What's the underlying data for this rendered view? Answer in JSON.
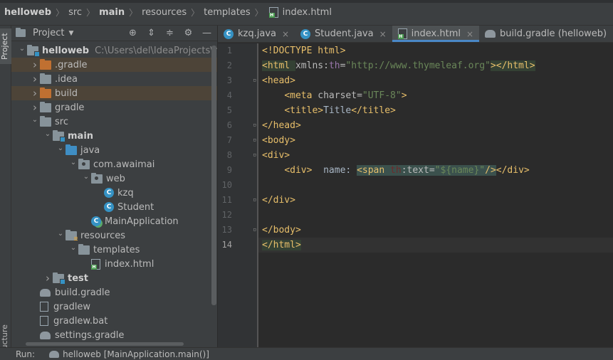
{
  "breadcrumb": [
    "helloweb",
    "src",
    "main",
    "resources",
    "templates",
    "index.html"
  ],
  "left_strip": {
    "project_tab": "Project",
    "structure_tab": "ructure"
  },
  "project_panel": {
    "title": "Project",
    "tools": [
      "locate-icon",
      "expand-all-icon",
      "collapse-all-icon",
      "gear-icon",
      "minimize-icon"
    ],
    "tree": [
      {
        "label": "helloweb",
        "extra": "C:\\Users\\del\\IdeaProjects\\hello",
        "icon": "module-folder-icon",
        "indent": 0,
        "expanded": true,
        "bold": true
      },
      {
        "label": ".gradle",
        "icon": "excluded-folder-icon",
        "indent": 1,
        "expanded": false,
        "hl": true
      },
      {
        "label": ".idea",
        "icon": "folder-icon",
        "indent": 1,
        "expanded": false
      },
      {
        "label": "build",
        "icon": "excluded-folder-icon",
        "indent": 1,
        "expanded": false,
        "hl": true
      },
      {
        "label": "gradle",
        "icon": "folder-icon",
        "indent": 1,
        "expanded": false
      },
      {
        "label": "src",
        "icon": "folder-icon",
        "indent": 1,
        "expanded": true
      },
      {
        "label": "main",
        "icon": "module-folder-icon",
        "indent": 2,
        "expanded": true,
        "bold": true
      },
      {
        "label": "java",
        "icon": "source-folder-icon",
        "indent": 3,
        "expanded": true
      },
      {
        "label": "com.awaimai",
        "icon": "package-icon",
        "indent": 4,
        "expanded": true
      },
      {
        "label": "web",
        "icon": "package-icon",
        "indent": 5,
        "expanded": true
      },
      {
        "label": "kzq",
        "icon": "class-icon",
        "indent": 6
      },
      {
        "label": "Student",
        "icon": "class-icon",
        "indent": 6
      },
      {
        "label": "MainApplication",
        "icon": "run-class-icon",
        "indent": 5
      },
      {
        "label": "resources",
        "icon": "resources-folder-icon",
        "indent": 3,
        "expanded": true
      },
      {
        "label": "templates",
        "icon": "folder-icon",
        "indent": 4,
        "expanded": true
      },
      {
        "label": "index.html",
        "icon": "html-file-icon",
        "indent": 5
      },
      {
        "label": "test",
        "icon": "module-folder-icon",
        "indent": 2,
        "expanded": false,
        "bold": true
      },
      {
        "label": "build.gradle",
        "icon": "gradle-icon",
        "indent": 1
      },
      {
        "label": "gradlew",
        "icon": "file-icon",
        "indent": 1
      },
      {
        "label": "gradlew.bat",
        "icon": "file-icon",
        "indent": 1
      },
      {
        "label": "settings.gradle",
        "icon": "gradle-icon",
        "indent": 1
      }
    ]
  },
  "editor": {
    "tabs": [
      {
        "label": "kzq.java",
        "icon": "class-icon",
        "active": false
      },
      {
        "label": "Student.java",
        "icon": "class-icon",
        "active": false
      },
      {
        "label": "index.html",
        "icon": "html-file-icon",
        "active": true
      },
      {
        "label": "build.gradle (helloweb)",
        "icon": "gradle-icon",
        "active": false
      }
    ],
    "close_glyph": "×",
    "line_numbers": [
      "1",
      "2",
      "3",
      "4",
      "5",
      "6",
      "7",
      "8",
      "9",
      "10",
      "11",
      "12",
      "13",
      "14"
    ],
    "current_line": 14
  },
  "runbar": {
    "label": "Run:",
    "config": "helloweb [MainApplication.main()]"
  }
}
